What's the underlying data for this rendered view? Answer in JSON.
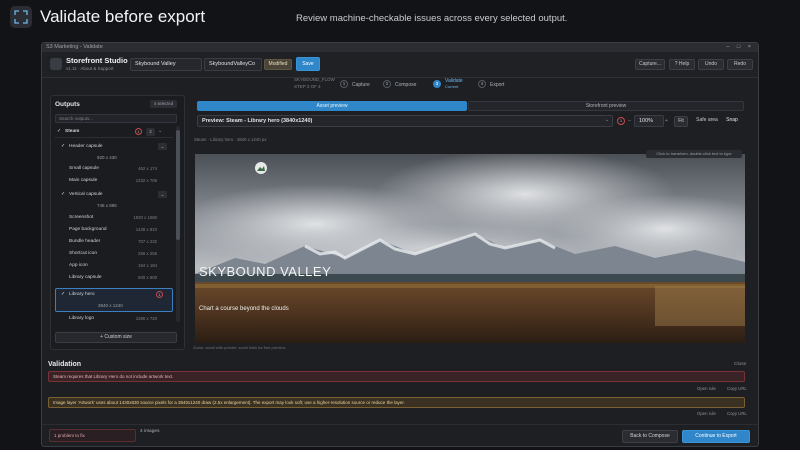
{
  "banner": {
    "title": "Validate before export",
    "subtitle": "Review machine-checkable issues across every selected output."
  },
  "window": {
    "title": "S3 Marketing - Validate",
    "controls": "– □ ×"
  },
  "header": {
    "app_name": "Storefront Studio",
    "app_version": "v1.11 · About & Support",
    "project_name": "Skybound Valley",
    "file_name": "SkyboundValleyCo",
    "modified_label": "Modified",
    "save_label": "Save",
    "actions": [
      "Capture...",
      "? Help",
      "Undo",
      "Redo"
    ]
  },
  "stepper": {
    "pre_label": "SKYBOUND_FLOW",
    "pre_sub": "STEP 3 OF 4",
    "steps": [
      {
        "num": "1",
        "label": "Capture",
        "active": false
      },
      {
        "num": "2",
        "label": "Compose",
        "active": false
      },
      {
        "num": "3",
        "label": "Validate",
        "sub": "Current",
        "active": true
      },
      {
        "num": "4",
        "label": "Export",
        "active": false
      }
    ]
  },
  "outputs": {
    "title": "Outputs",
    "badge": "4 selected",
    "search_placeholder": "Search outputs...",
    "group_label": "Steam",
    "group_issue_count": "1",
    "group_count": "2",
    "items": [
      {
        "label": "Header capsule",
        "dim": "",
        "checked": true
      },
      {
        "label": "",
        "dim": "920 x 430",
        "checked": false,
        "center": true
      },
      {
        "label": "Small capsule",
        "dim": "462 x 174",
        "checked": false
      },
      {
        "label": "Main capsule",
        "dim": "1232 x 706",
        "checked": false
      },
      {
        "label": "Vertical capsule",
        "dim": "",
        "checked": true
      },
      {
        "label": "",
        "dim": "748 x 896",
        "checked": false,
        "center": true
      },
      {
        "label": "Screenshot",
        "dim": "1920 x 1080",
        "checked": false
      },
      {
        "label": "Page background",
        "dim": "1438 x 810",
        "checked": false
      },
      {
        "label": "Bundle header",
        "dim": "707 x 232",
        "checked": false
      },
      {
        "label": "Shortcut icon",
        "dim": "256 x 256",
        "checked": false
      },
      {
        "label": "App icon",
        "dim": "184 x 184",
        "checked": false
      },
      {
        "label": "Library capsule",
        "dim": "600 x 900",
        "checked": false
      },
      {
        "label": "Library hero",
        "dim": "",
        "checked": true,
        "selected": true
      },
      {
        "label": "",
        "dim": "3840 x 1240",
        "checked": false,
        "center": true
      },
      {
        "label": "Library logo",
        "dim": "1280 x 720",
        "checked": false
      }
    ],
    "custom_size_label": "+ Custom size"
  },
  "preview": {
    "tab_asset": "Asset preview",
    "tab_storefront": "Storefront preview",
    "select_value": "Preview: Steam - Library hero (3840x1240)",
    "issue_badge": "1",
    "zoom": "100%",
    "fit_label": "Fit",
    "safe_label": "Safe area",
    "snap_label": "Snap",
    "breadcrumb": "Steam   ·   Library hero   ·   3840 x 1240 px",
    "hint": "Click to transform, double-click text to type",
    "hero_title": "SKYBOUND VALLEY",
    "hero_tagline": "Chart a course beyond the clouds",
    "below_hint": "Zoom: scroll with pointer; scroll links for fine preview."
  },
  "validation": {
    "title": "Validation",
    "close_label": "Close",
    "issues": [
      {
        "severity": "error",
        "text": "Steam requires that Library Hero do not include artwork text.",
        "links": [
          "Open rule",
          "Copy URL"
        ]
      },
      {
        "severity": "warning",
        "text": "Image layer 'Artwork' uses about 1430x830 source pixels for a 3840x1240 draw (2.5x enlargement). The export may look soft; use a higher-resolution source or reduce the layer.",
        "links": [
          "Open rule",
          "Copy URL"
        ]
      }
    ]
  },
  "footer": {
    "error_summary": "1 problem to fix",
    "image_count": "4 images",
    "back_label": "Back to Compose",
    "continue_label": "Continue to Export"
  }
}
